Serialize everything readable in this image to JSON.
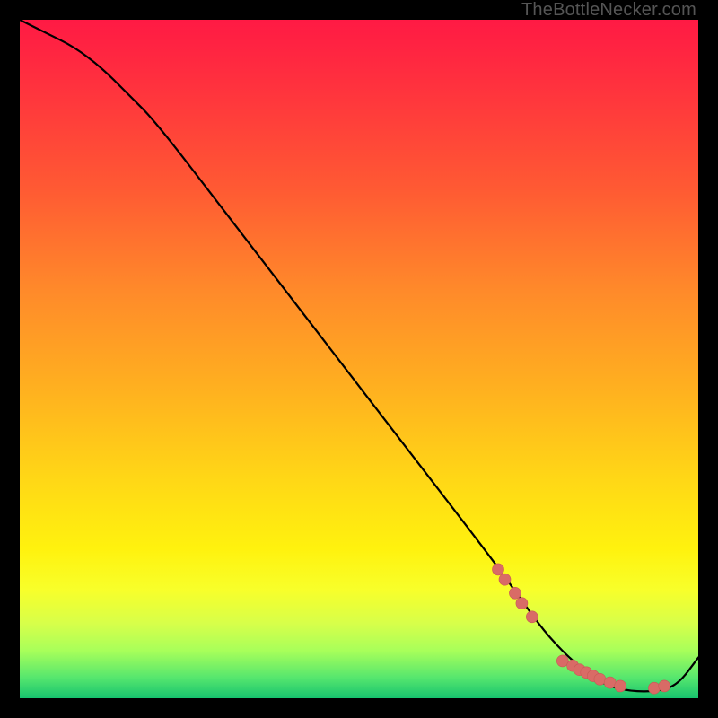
{
  "watermark": "TheBottleNecker.com",
  "colors": {
    "dot": "#d96b66",
    "dot_stroke": "#c85a55",
    "line": "#000000",
    "background_black": "#000000"
  },
  "chart_data": {
    "type": "line",
    "title": "",
    "xlabel": "",
    "ylabel": "",
    "xlim": [
      0,
      100
    ],
    "ylim": [
      0,
      100
    ],
    "series": [
      {
        "name": "bottleneck-curve",
        "x": [
          0,
          4,
          8,
          12,
          16,
          20,
          30,
          40,
          50,
          60,
          70,
          75,
          78,
          82,
          86,
          90,
          94,
          97,
          100
        ],
        "y": [
          100,
          98,
          96,
          93,
          89,
          85,
          72,
          59,
          46,
          33,
          20,
          13,
          9,
          5,
          2,
          1,
          1,
          2,
          6
        ]
      }
    ],
    "marker_clusters": [
      {
        "name": "upper-cluster",
        "points": [
          {
            "x": 70.5,
            "y": 19.0
          },
          {
            "x": 71.5,
            "y": 17.5
          },
          {
            "x": 73.0,
            "y": 15.5
          },
          {
            "x": 74.0,
            "y": 14.0
          },
          {
            "x": 75.5,
            "y": 12.0
          }
        ]
      },
      {
        "name": "bottom-cluster",
        "points": [
          {
            "x": 80.0,
            "y": 5.5
          },
          {
            "x": 81.5,
            "y": 4.8
          },
          {
            "x": 82.5,
            "y": 4.2
          },
          {
            "x": 83.5,
            "y": 3.8
          },
          {
            "x": 84.5,
            "y": 3.3
          },
          {
            "x": 85.5,
            "y": 2.8
          },
          {
            "x": 87.0,
            "y": 2.3
          },
          {
            "x": 88.5,
            "y": 1.8
          },
          {
            "x": 93.5,
            "y": 1.5
          },
          {
            "x": 95.0,
            "y": 1.8
          }
        ]
      }
    ]
  }
}
